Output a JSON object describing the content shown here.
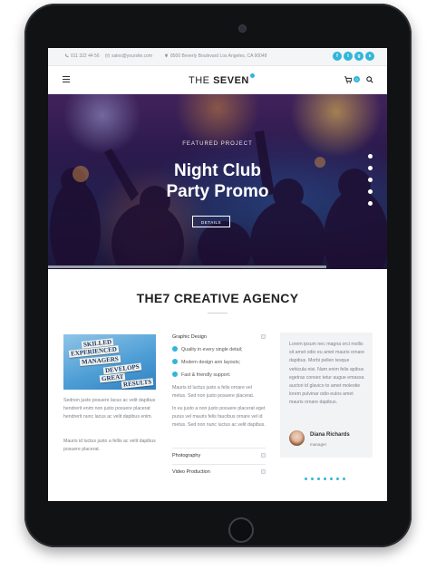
{
  "topbar": {
    "phone": "011 322 44 56",
    "email": "sales@yoursite.com",
    "address": "8500 Beverly Boulevard Los Angeles, CA 90048",
    "social_icons": [
      "facebook-icon",
      "twitter-icon",
      "google-plus-icon",
      "skype-icon"
    ]
  },
  "header": {
    "logo_part1": "THE ",
    "logo_part2": "SEVEN",
    "cart_count": "0"
  },
  "hero": {
    "eyebrow": "FEATURED PROJECT",
    "title_line1": "Night Club",
    "title_line2": "Party Promo",
    "button_label": "DETAILS",
    "slide_dots": 5,
    "progress": 0.82
  },
  "section": {
    "title": "THE7 CREATIVE AGENCY"
  },
  "left_col": {
    "image_words": [
      "SKILLED",
      "EXPERIENCED",
      "MANAGERS",
      "DEVELOPS",
      "GREAT",
      "RESULTS"
    ],
    "para1": "Sednon justo posuere lacus ac velit dapibus hendrerit enim non justo posuere placerat hendrerit nunc lacus ac velit dapibus enim.",
    "para2": "Mauris id luctus justo a fellis ac velit dapibus posuere placerat."
  },
  "mid_col": {
    "acc1_title": "Graphic Design",
    "bullets": [
      "Quality in every single detail;",
      "Modern design ann layouts;",
      "Fast & friendly support."
    ],
    "para1": "Mauris id luctus justo a felis ornare vel metus. Sed non justo posuere placerat.",
    "para2": "In eu justo a non justo posuere placerat eget purus vel mauris felis faucibus ornare vel id metus. Sed non nunc luctus ac velit dapibus.",
    "acc2_title": "Photography",
    "acc3_title": "Video Production"
  },
  "testimonial": {
    "text": "Lorem ipsum nec magna orci mollis sit amet odio eu amet mauris ornare dapibus. Morbi pellen tesque vehicula nisi. Nam enim felis apibus egetras consec tetur augue emassa auctori id glavico to amet molestie lorem pulvinar odio eulos amet mauris ornare dapibus.",
    "name": "Diana Richards",
    "role": "manager",
    "dots": 7
  },
  "colors": {
    "accent": "#32b5da"
  }
}
